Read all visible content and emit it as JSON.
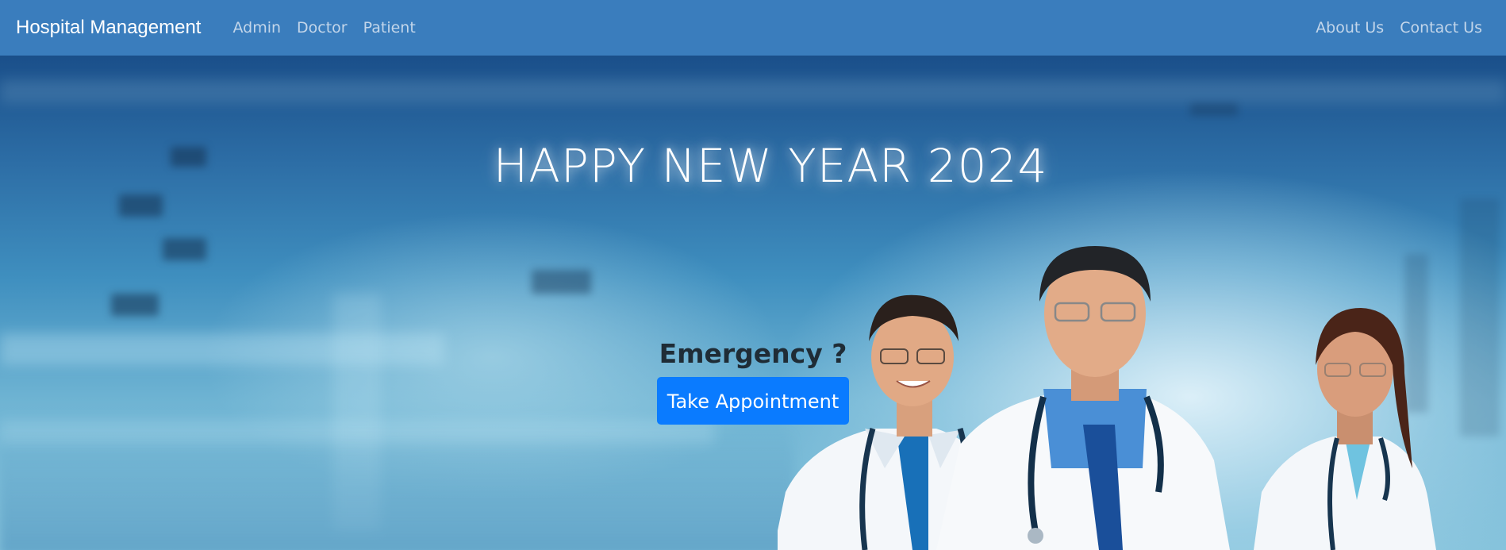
{
  "navbar": {
    "brand": "Hospital Management",
    "left_links": [
      {
        "label": "Admin"
      },
      {
        "label": "Doctor"
      },
      {
        "label": "Patient"
      }
    ],
    "right_links": [
      {
        "label": "About Us"
      },
      {
        "label": "Contact Us"
      }
    ]
  },
  "hero": {
    "headline": "HAPPY NEW YEAR 2024",
    "emergency_title": "Emergency ?",
    "appointment_button": "Take Appointment"
  },
  "colors": {
    "navbar_bg": "#3a7dbd",
    "nav_link": "#c3d6ea",
    "button_bg": "#0a7bff",
    "button_text": "#ffffff"
  }
}
